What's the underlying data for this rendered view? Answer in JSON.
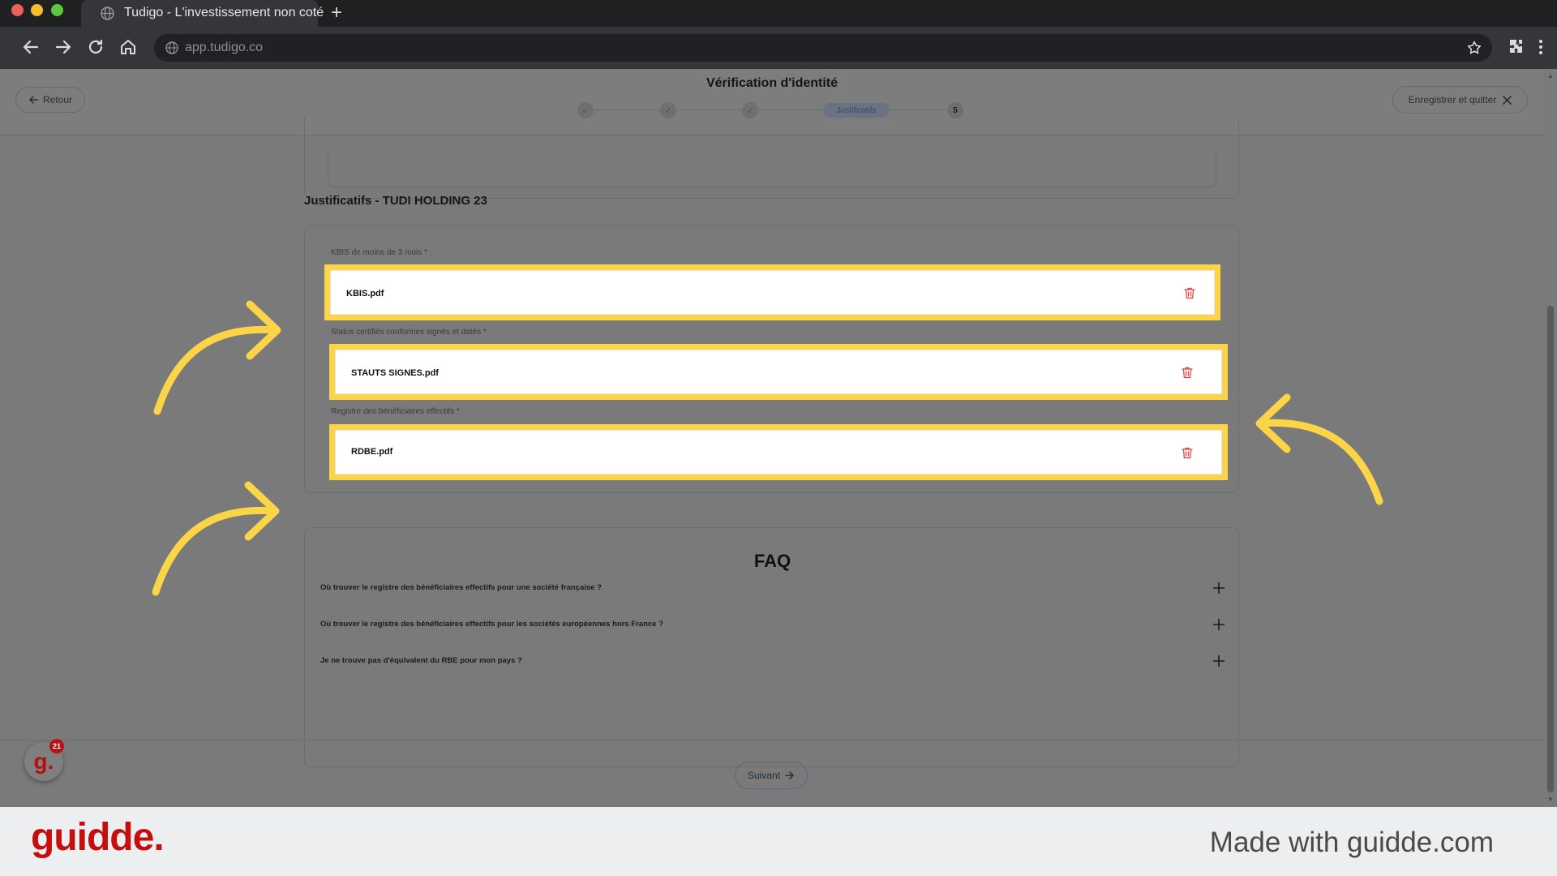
{
  "browser": {
    "tab_title": "Tudigo - L'investissement non coté",
    "new_tab": "+",
    "url": "app.tudigo.co"
  },
  "header": {
    "back_label": "Retour",
    "title": "Vérification d'identité",
    "steps": [
      "✓",
      "✓",
      "✓",
      "Justificatifs",
      "5"
    ],
    "save_quit_label": "Enregistrer et quitter"
  },
  "documents": {
    "section_title": "Justificatifs - TUDI HOLDING 23",
    "fields": [
      {
        "label": "KBIS de moins de 3 mois *",
        "file": "KBIS.pdf"
      },
      {
        "label": "Status certifiés conformes signés et datés *",
        "file": "STAUTS SIGNES.pdf"
      },
      {
        "label": "Registre des bénéficiaires effectifs *",
        "file": "RDBE.pdf"
      }
    ]
  },
  "faq": {
    "title": "FAQ",
    "items": [
      "Où trouver le registre des bénéficiaires effectifs pour une société française ?",
      "Où trouver le registre des bénéficiaires effectifs pour les sociétés européennes hors France ?",
      "Je ne trouve pas d'équivalent du RBE pour mon pays ?"
    ]
  },
  "footer": {
    "next_label": "Suivant"
  },
  "guidde_widget": {
    "letter": "g.",
    "count": "21"
  },
  "branding": {
    "logo": "guidde.",
    "made_with": "Made with guidde.com"
  },
  "colors": {
    "highlight": "#fcd447",
    "brand_red": "#c50f0f",
    "trash_red": "#e53935"
  }
}
